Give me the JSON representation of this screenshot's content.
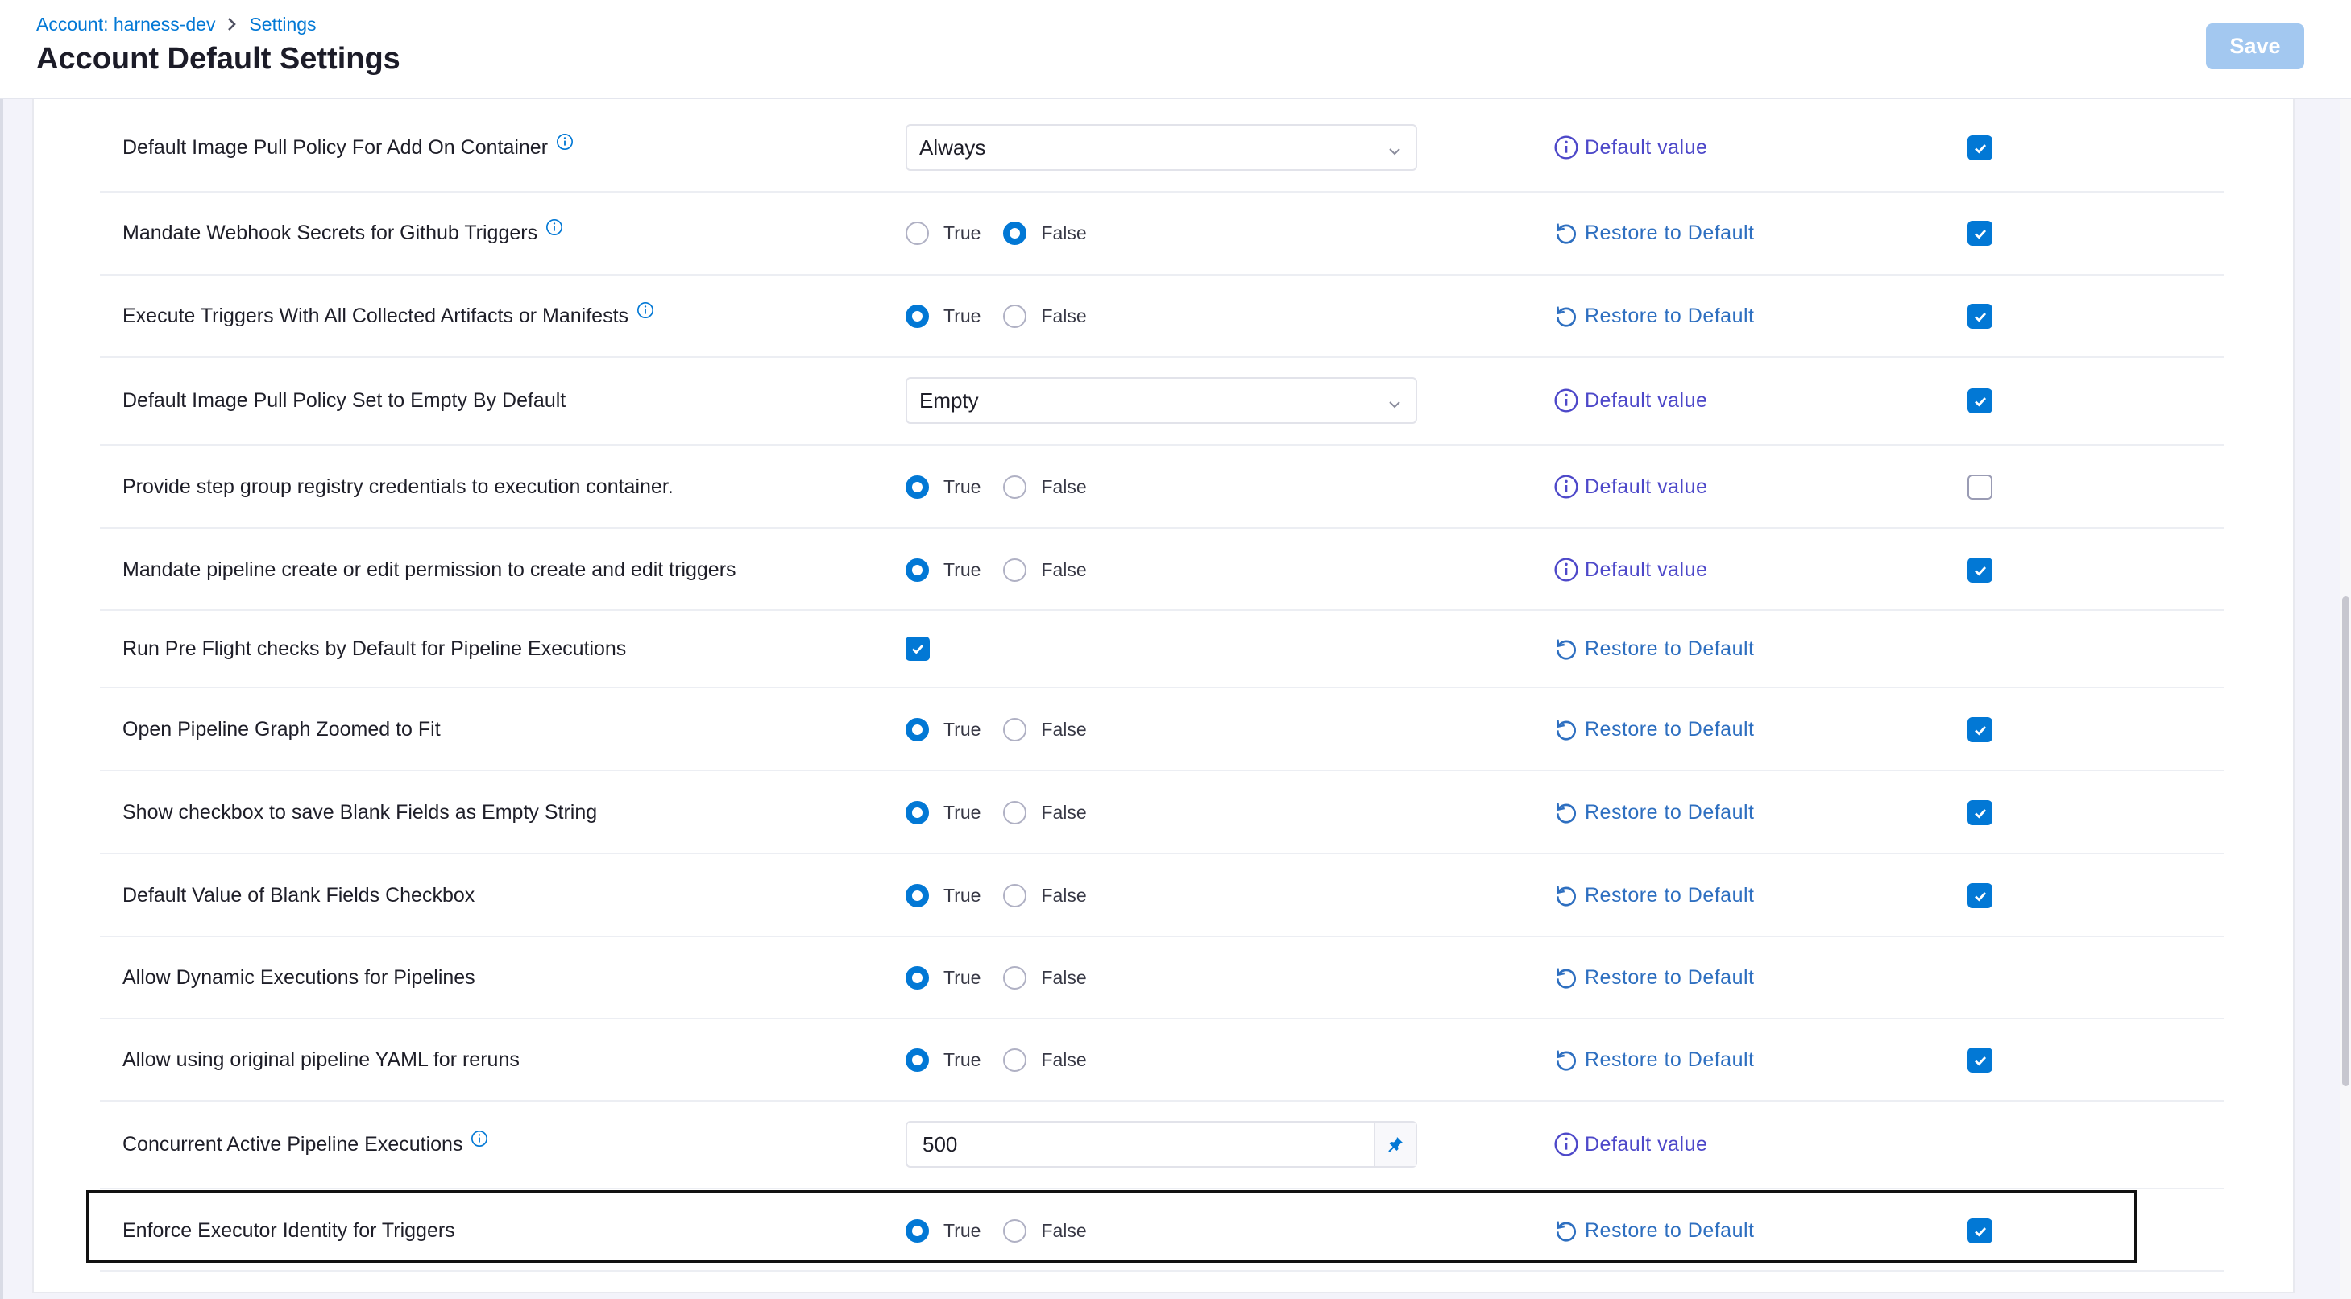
{
  "breadcrumb": {
    "account": "Account: harness-dev",
    "settings": "Settings"
  },
  "page_title": "Account Default Settings",
  "save_label": "Save",
  "radio_labels": {
    "true": "True",
    "false": "False"
  },
  "actions": {
    "default_value": "Default value",
    "restore": "Restore to Default"
  },
  "colors": {
    "accent": "#0278d5",
    "link": "#2e6fc0",
    "default_link": "#4d48c9",
    "save_disabled": "#a3c8f0"
  },
  "rows": [
    {
      "label": "Default Image Pull Policy For Add On Container",
      "info": true,
      "control": "select",
      "value": "Always",
      "action": "default",
      "override": true
    },
    {
      "label": "Mandate Webhook Secrets for Github Triggers",
      "info": true,
      "control": "radio",
      "selected": "false",
      "action": "restore",
      "override": true
    },
    {
      "label": "Execute Triggers With All Collected Artifacts or Manifests",
      "info": true,
      "control": "radio",
      "selected": "true",
      "action": "restore",
      "override": true
    },
    {
      "label": "Default Image Pull Policy Set to Empty By Default",
      "info": false,
      "control": "select",
      "value": "Empty",
      "action": "default",
      "override": true
    },
    {
      "label": "Provide step group registry credentials to execution container.",
      "info": false,
      "control": "radio",
      "selected": "true",
      "action": "default",
      "override": false
    },
    {
      "label": "Mandate pipeline create or edit permission to create and edit triggers",
      "info": false,
      "control": "radio",
      "selected": "true",
      "action": "default",
      "override": true
    },
    {
      "label": "Run Pre Flight checks by Default for Pipeline Executions",
      "info": false,
      "control": "checkbox",
      "checked": true,
      "action": "restore",
      "override": null
    },
    {
      "label": "Open Pipeline Graph Zoomed to Fit",
      "info": false,
      "control": "radio",
      "selected": "true",
      "action": "restore",
      "override": true
    },
    {
      "label": "Show checkbox to save Blank Fields as Empty String",
      "info": false,
      "control": "radio",
      "selected": "true",
      "action": "restore",
      "override": true
    },
    {
      "label": "Default Value of Blank Fields Checkbox",
      "info": false,
      "control": "radio",
      "selected": "true",
      "action": "restore",
      "override": true
    },
    {
      "label": "Allow Dynamic Executions for Pipelines",
      "info": false,
      "control": "radio",
      "selected": "true",
      "action": "restore",
      "override": null
    },
    {
      "label": "Allow using original pipeline YAML for reruns",
      "info": false,
      "control": "radio",
      "selected": "true",
      "action": "restore",
      "override": true
    },
    {
      "label": "Concurrent Active Pipeline Executions",
      "info": true,
      "control": "number",
      "value": "500",
      "action": "default",
      "override": null
    },
    {
      "label": "Enforce Executor Identity for Triggers",
      "info": false,
      "control": "radio",
      "selected": "true",
      "action": "restore",
      "override": true,
      "highlighted": true
    }
  ]
}
